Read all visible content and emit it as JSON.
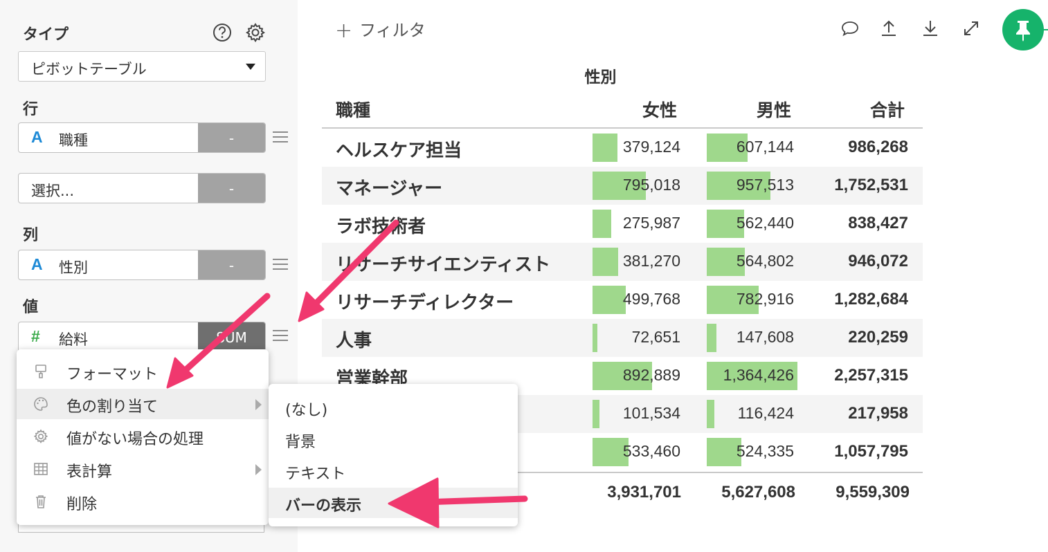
{
  "sidebar": {
    "type_label": "タイプ",
    "chart_type": "ピボットテーブル",
    "rows_label": "行",
    "row_field": "職種",
    "row_field_agg": "-",
    "row_placeholder": "選択...",
    "row_placeholder_agg": "-",
    "cols_label": "列",
    "col_field": "性別",
    "col_field_agg": "-",
    "values_label": "値",
    "value_field": "給料",
    "value_field_agg": "SUM"
  },
  "toolbar": {
    "filter_plus": "+",
    "filter_label": "フィルタ",
    "icons": [
      "comment-icon",
      "upload-icon",
      "download-icon",
      "expand-icon",
      "pin-icon"
    ],
    "accent_color": "#16b36b"
  },
  "pivot": {
    "column_group": "性別",
    "headers": {
      "row": "職種",
      "female": "女性",
      "male": "男性",
      "total": "合計"
    },
    "bar_color": "#9fd88c",
    "rows": [
      {
        "name": "ヘルスケア担当",
        "female": "379,124",
        "male": "607,144",
        "total": "986,268"
      },
      {
        "name": "マネージャー",
        "female": "795,018",
        "male": "957,513",
        "total": "1,752,531"
      },
      {
        "name": "ラボ技術者",
        "female": "275,987",
        "male": "562,440",
        "total": "838,427"
      },
      {
        "name": "リサーチサイエンティスト",
        "female": "381,270",
        "male": "564,802",
        "total": "946,072"
      },
      {
        "name": "リサーチディレクター",
        "female": "499,768",
        "male": "782,916",
        "total": "1,282,684"
      },
      {
        "name": "人事",
        "female": "72,651",
        "male": "147,608",
        "total": "220,259"
      },
      {
        "name": "営業幹部",
        "female": "892,889",
        "male": "1,364,426",
        "total": "2,257,315"
      },
      {
        "name": "",
        "female": "101,534",
        "male": "116,424",
        "total": "217,958"
      },
      {
        "name": "",
        "female": "533,460",
        "male": "524,335",
        "total": "1,057,795"
      }
    ],
    "totals": {
      "female": "3,931,701",
      "male": "5,627,608",
      "total": "9,559,309"
    }
  },
  "context_menu": {
    "items": [
      {
        "label": "フォーマット",
        "icon": "paint-roller-icon"
      },
      {
        "label": "色の割り当て",
        "icon": "palette-icon"
      },
      {
        "label": "値がない場合の処理",
        "icon": "gear-icon"
      },
      {
        "label": "表計算",
        "icon": "table-icon"
      },
      {
        "label": "削除",
        "icon": "trash-icon"
      }
    ]
  },
  "color_submenu": {
    "items": [
      {
        "label": "(なし)"
      },
      {
        "label": "背景"
      },
      {
        "label": "テキスト"
      },
      {
        "label": "バーの表示"
      }
    ]
  },
  "annotation_color": "#f0386e"
}
